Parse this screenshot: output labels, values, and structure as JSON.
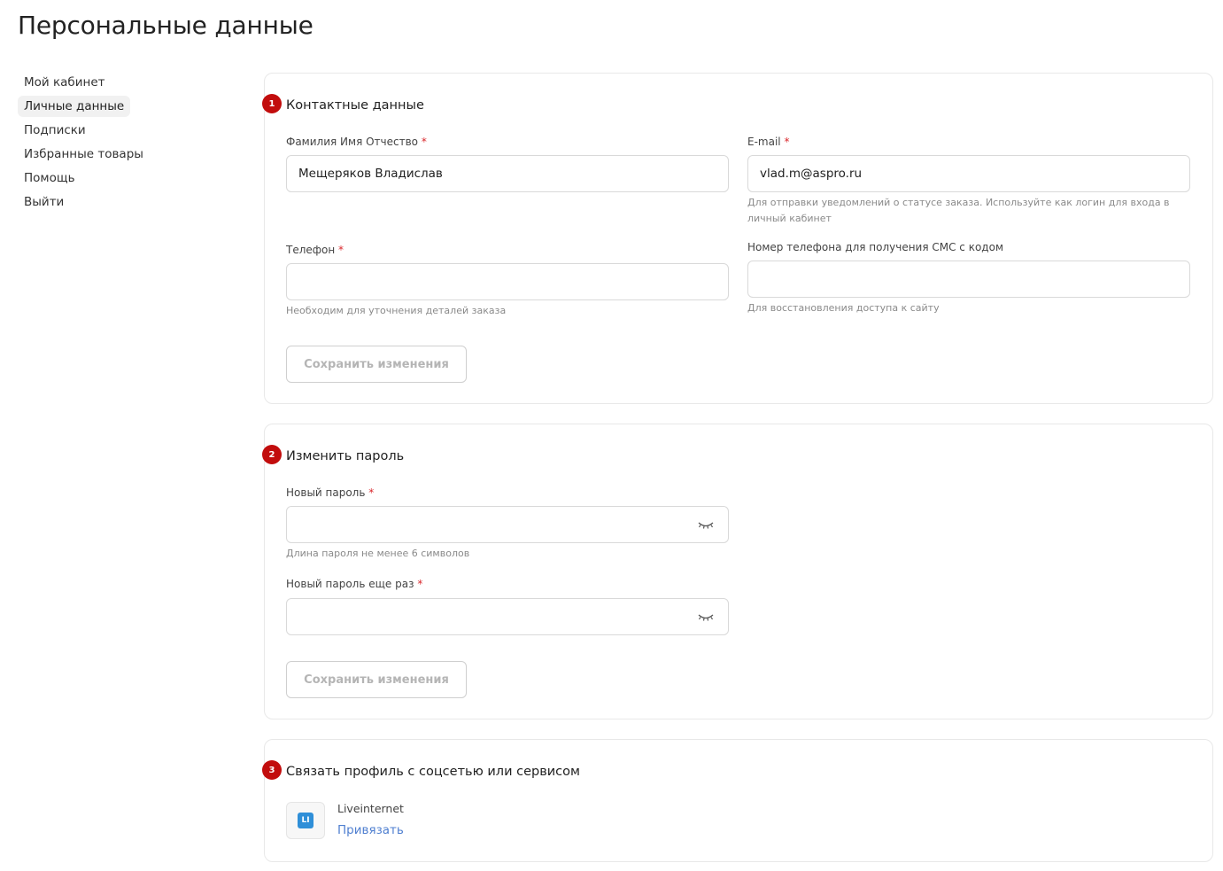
{
  "page": {
    "title": "Персональные данные"
  },
  "sidebar": {
    "items": [
      {
        "label": "Мой кабинет",
        "active": false
      },
      {
        "label": "Личные данные",
        "active": true
      },
      {
        "label": "Подписки",
        "active": false
      },
      {
        "label": "Избранные товары",
        "active": false
      },
      {
        "label": "Помощь",
        "active": false
      },
      {
        "label": "Выйти",
        "active": false
      }
    ]
  },
  "required_mark": "*",
  "contacts": {
    "badge": "1",
    "title": "Контактные данные",
    "fio": {
      "label": "Фамилия Имя Отчество",
      "value": "Мещеряков Владислав"
    },
    "email": {
      "label": "E-mail",
      "value": "vlad.m@aspro.ru",
      "hint": "Для отправки уведомлений о статусе заказа. Используйте как логин для входа в личный кабинет"
    },
    "phone": {
      "label": "Телефон",
      "value": "",
      "hint": "Необходим для уточнения деталей заказа"
    },
    "sms_phone": {
      "label": "Номер телефона для получения СМС с кодом",
      "value": "",
      "hint": "Для восстановления доступа к сайту"
    },
    "save_label": "Сохранить изменения"
  },
  "password": {
    "badge": "2",
    "title": "Изменить пароль",
    "new": {
      "label": "Новый пароль",
      "value": "",
      "hint": "Длина пароля не менее 6 символов"
    },
    "repeat": {
      "label": "Новый пароль еще раз",
      "value": ""
    },
    "save_label": "Сохранить изменения"
  },
  "social": {
    "badge": "3",
    "title": "Связать профиль с соцсетью или сервисом",
    "service": {
      "icon_text": "LI",
      "name": "Liveinternet",
      "link_label": "Привязать"
    }
  },
  "colors": {
    "badge": "#c20d0d",
    "required": "#d9262b",
    "link": "#4f7fd0",
    "service_icon": "#2f8fd8"
  },
  "icons": {
    "password_toggle": "eye-closed-icon"
  }
}
